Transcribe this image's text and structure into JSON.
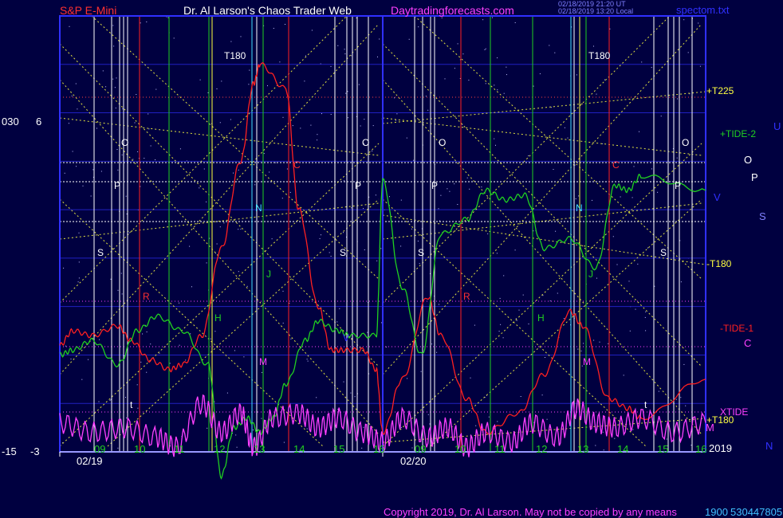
{
  "header": {
    "instrument": "S&P E-Mini",
    "author": "Dr. Al Larson's Chaos Trader Web",
    "site": "Daytradingforecasts.com",
    "stamp_line1": "02/18/2019 21:20 UT",
    "stamp_line2": "02/18/2019 13:20 Local",
    "file": "spectom.txt"
  },
  "axes": {
    "left_top_outer": "030",
    "left_top_inner": "6",
    "left_bottom_outer": "-15",
    "left_bottom_inner": "-3",
    "year_label": "2019",
    "x_dates": [
      "02/19",
      "02/20"
    ],
    "x_hours_day1": [
      "09",
      "10",
      "11",
      "12",
      "13",
      "14",
      "15",
      "16"
    ],
    "x_hours_day2": [
      "09",
      "10",
      "11",
      "12",
      "13",
      "14",
      "15",
      "16"
    ]
  },
  "legend": {
    "t225": "+T225",
    "tide2": "+TIDE-2",
    "t180_mid": "-T180",
    "tide1": "-TIDE-1",
    "xtide": "XTIDE",
    "t180_low": "+T180"
  },
  "right_letters": {
    "U": "U",
    "O": "O",
    "P": "P",
    "V": "V",
    "S": "S",
    "C": "C",
    "M": "M",
    "N": "N"
  },
  "footer": {
    "copyright": "Copyright 2019, Dr. Al Larson. May not be copied by any means",
    "code": "1900",
    "serial": "530447805"
  },
  "colors": {
    "background": "#000040",
    "plot_frame": "#3030ff",
    "red_curve": "#ff2020",
    "green_curve": "#20d020",
    "magenta_curve": "#ff40ff",
    "yellow_dotted": "#e0e040",
    "white_lines": "#ffffff",
    "title_red": "#ff3030",
    "title_white": "#ffffff",
    "title_magenta": "#ff40ff"
  },
  "chart_data": {
    "type": "line",
    "series": [
      {
        "name": "-TIDE-1",
        "color": "red",
        "values": [
          [
            0,
            -0.8
          ],
          [
            0.02,
            -0.5
          ],
          [
            0.05,
            -0.6
          ],
          [
            0.09,
            -0.4
          ],
          [
            0.11,
            -0.7
          ],
          [
            0.14,
            -1.1
          ],
          [
            0.17,
            -1.3
          ],
          [
            0.19,
            -1.2
          ],
          [
            0.22,
            -0.6
          ],
          [
            0.25,
            1.2
          ],
          [
            0.28,
            3.0
          ],
          [
            0.3,
            4.6
          ],
          [
            0.31,
            5.0
          ],
          [
            0.35,
            4.5
          ],
          [
            0.37,
            2.0
          ],
          [
            0.4,
            0.0
          ],
          [
            0.42,
            -0.9
          ],
          [
            0.44,
            -0.9
          ],
          [
            0.47,
            -0.9
          ],
          [
            0.49,
            -1.3
          ],
          [
            0.5,
            -2.6
          ],
          [
            0.53,
            -1.5
          ],
          [
            0.57,
            0.2
          ],
          [
            0.59,
            -0.6
          ],
          [
            0.63,
            -1.9
          ],
          [
            0.66,
            -2.6
          ],
          [
            0.71,
            -2.2
          ],
          [
            0.75,
            -1.4
          ],
          [
            0.79,
            -0.1
          ],
          [
            0.81,
            -0.4
          ],
          [
            0.85,
            -1.9
          ],
          [
            0.88,
            -2.1
          ],
          [
            0.9,
            -2.3
          ],
          [
            1.0,
            -1.5
          ]
        ]
      },
      {
        "name": "+TIDE-2",
        "color": "green",
        "values": [
          [
            0,
            -1.0
          ],
          [
            0.02,
            -0.9
          ],
          [
            0.05,
            -0.7
          ],
          [
            0.09,
            -1.2
          ],
          [
            0.12,
            -0.5
          ],
          [
            0.15,
            -0.2
          ],
          [
            0.19,
            -0.5
          ],
          [
            0.23,
            -1.2
          ],
          [
            0.25,
            -3.5
          ],
          [
            0.27,
            -2.5
          ],
          [
            0.29,
            -2.3
          ],
          [
            0.31,
            -2.6
          ],
          [
            0.33,
            -2.3
          ],
          [
            0.35,
            -1.6
          ],
          [
            0.38,
            -0.7
          ],
          [
            0.4,
            -0.3
          ],
          [
            0.43,
            -0.5
          ],
          [
            0.45,
            -0.6
          ],
          [
            0.49,
            -0.6
          ],
          [
            0.5,
            2.6
          ],
          [
            0.53,
            0.4
          ],
          [
            0.56,
            -1.0
          ],
          [
            0.59,
            1.5
          ],
          [
            0.63,
            1.8
          ],
          [
            0.66,
            2.4
          ],
          [
            0.69,
            2.2
          ],
          [
            0.72,
            2.3
          ],
          [
            0.75,
            1.2
          ],
          [
            0.79,
            1.4
          ],
          [
            0.83,
            0.8
          ],
          [
            0.86,
            2.5
          ],
          [
            0.88,
            2.4
          ],
          [
            0.9,
            2.7
          ],
          [
            1.0,
            2.4
          ]
        ]
      },
      {
        "name": "XTIDE",
        "color": "magenta",
        "values": [
          [
            0,
            -2.4
          ],
          [
            0.05,
            -2.6
          ],
          [
            0.1,
            -2.5
          ],
          [
            0.15,
            -2.7
          ],
          [
            0.18,
            -2.9
          ],
          [
            0.22,
            -2.0
          ],
          [
            0.25,
            -2.6
          ],
          [
            0.28,
            -2.2
          ],
          [
            0.3,
            -2.9
          ],
          [
            0.33,
            -2.3
          ],
          [
            0.37,
            -2.2
          ],
          [
            0.4,
            -2.5
          ],
          [
            0.43,
            -2.3
          ],
          [
            0.47,
            -2.6
          ],
          [
            0.5,
            -2.8
          ],
          [
            0.53,
            -2.3
          ],
          [
            0.57,
            -2.7
          ],
          [
            0.6,
            -2.5
          ],
          [
            0.63,
            -2.9
          ],
          [
            0.66,
            -2.6
          ],
          [
            0.7,
            -2.8
          ],
          [
            0.73,
            -2.4
          ],
          [
            0.77,
            -2.7
          ],
          [
            0.8,
            -2.1
          ],
          [
            0.83,
            -2.4
          ],
          [
            0.86,
            -2.5
          ],
          [
            0.9,
            -2.3
          ],
          [
            0.95,
            -2.6
          ],
          [
            1.0,
            -2.4
          ]
        ]
      }
    ],
    "ylim": [
      -3,
      6
    ],
    "xlabel": "",
    "ylabel": ""
  },
  "chart_letters": [
    {
      "t": "O",
      "x": 152,
      "y": 183,
      "c": "#ffffff"
    },
    {
      "t": "P",
      "x": 143,
      "y": 237,
      "c": "#ffffff"
    },
    {
      "t": "S",
      "x": 122,
      "y": 321,
      "c": "#ffffff"
    },
    {
      "t": "R",
      "x": 179,
      "y": 376,
      "c": "#ff3030"
    },
    {
      "t": "H",
      "x": 269,
      "y": 403,
      "c": "#20d020"
    },
    {
      "t": "T180",
      "x": 281,
      "y": 74,
      "c": "#ffffff"
    },
    {
      "t": "N",
      "x": 320,
      "y": 265,
      "c": "#40e0ff"
    },
    {
      "t": "J",
      "x": 334,
      "y": 348,
      "c": "#20d020"
    },
    {
      "t": "M",
      "x": 325,
      "y": 458,
      "c": "#ff40ff"
    },
    {
      "t": "C",
      "x": 368,
      "y": 211,
      "c": "#ff3030"
    },
    {
      "t": "O",
      "x": 454,
      "y": 183,
      "c": "#ffffff"
    },
    {
      "t": "P",
      "x": 445,
      "y": 237,
      "c": "#ffffff"
    },
    {
      "t": "S",
      "x": 426,
      "y": 321,
      "c": "#ffffff"
    },
    {
      "t": "V",
      "x": 430,
      "y": 428,
      "c": "#3030ff"
    },
    {
      "t": "t",
      "x": 163,
      "y": 512,
      "c": "#ffffff"
    },
    {
      "t": "O",
      "x": 550,
      "y": 183,
      "c": "#ffffff"
    },
    {
      "t": "P",
      "x": 541,
      "y": 237,
      "c": "#ffffff"
    },
    {
      "t": "S",
      "x": 524,
      "y": 321,
      "c": "#ffffff"
    },
    {
      "t": "R",
      "x": 581,
      "y": 376,
      "c": "#ff3030"
    },
    {
      "t": "H",
      "x": 674,
      "y": 403,
      "c": "#20d020"
    },
    {
      "t": "T180",
      "x": 738,
      "y": 74,
      "c": "#ffffff"
    },
    {
      "t": "N",
      "x": 722,
      "y": 265,
      "c": "#40e0ff"
    },
    {
      "t": "J",
      "x": 738,
      "y": 348,
      "c": "#20d020"
    },
    {
      "t": "M",
      "x": 731,
      "y": 458,
      "c": "#ff40ff"
    },
    {
      "t": "C",
      "x": 768,
      "y": 211,
      "c": "#ff3030"
    },
    {
      "t": "O",
      "x": 855,
      "y": 183,
      "c": "#ffffff"
    },
    {
      "t": "P",
      "x": 846,
      "y": 237,
      "c": "#ffffff"
    },
    {
      "t": "S",
      "x": 828,
      "y": 321,
      "c": "#ffffff"
    },
    {
      "t": "t",
      "x": 808,
      "y": 512,
      "c": "#ffffff"
    }
  ]
}
